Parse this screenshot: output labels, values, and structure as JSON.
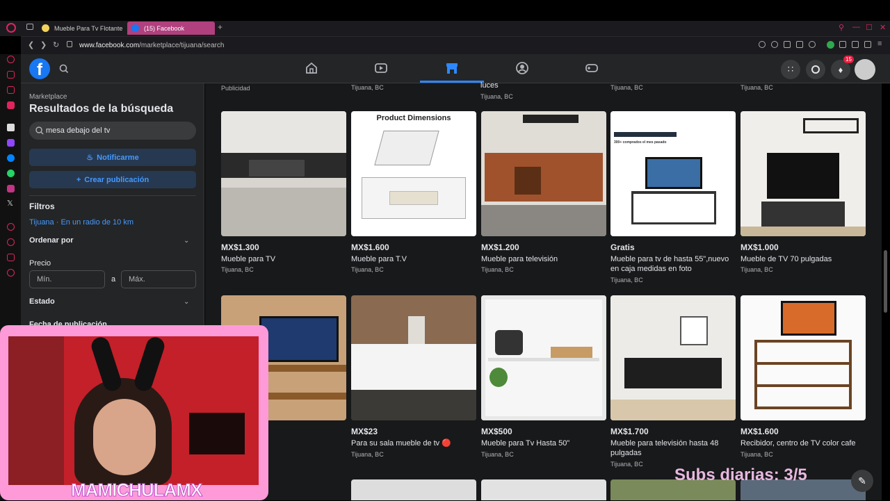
{
  "browser": {
    "tabs": [
      {
        "label": "Mueble Para Tv Flotante"
      },
      {
        "label": "(15) Facebook"
      }
    ],
    "new_tab": "+",
    "url_host": "www.facebook.com",
    "url_path": "/marketplace/tijuana/search"
  },
  "fb": {
    "logo": "f",
    "notif_count": "15"
  },
  "sidebar": {
    "crumb": "Marketplace",
    "title": "Resultados de la búsqueda",
    "search_value": "mesa debajo del tv",
    "notify_label": "Notificarme",
    "create_label": "Crear publicación",
    "filters_title": "Filtros",
    "location": "Tijuana · En un radio de 10 km",
    "sort_label": "Ordenar por",
    "price_label": "Precio",
    "min_placeholder": "Mín.",
    "to_label": "a",
    "max_placeholder": "Máx.",
    "state_label": "Estado",
    "date_label": "Fecha de publicación"
  },
  "top_row_labels": [
    "Publicidad",
    "Tijuana, BC",
    "luces",
    "Tijuana, BC",
    "Tijuana, BC",
    "Tijuana, BC"
  ],
  "listings_row1": [
    {
      "price": "MX$1.300",
      "title": "Mueble para TV",
      "location": "Tijuana, BC"
    },
    {
      "price": "MX$1.600",
      "title": "Mueble para T.V",
      "location": "Tijuana, BC",
      "img_text": "Product Dimensions"
    },
    {
      "price": "MX$1.200",
      "title": "Mueble para televisión",
      "location": "Tijuana, BC"
    },
    {
      "price": "Gratis",
      "title": "Mueble para tv de hasta 55\",nuevo en caja medidas en foto",
      "location": "Tijuana, BC",
      "img_text": "300+ comprados el mes pasado"
    },
    {
      "price": "MX$1.000",
      "title": "Mueble de TV 70 pulgadas",
      "location": "Tijuana, BC"
    }
  ],
  "listings_row2": [
    {
      "price": "",
      "title": "",
      "location": ""
    },
    {
      "price": "MX$23",
      "title": "Para su sala mueble de tv 🔴",
      "location": "Tijuana, BC"
    },
    {
      "price": "MX$500",
      "title": "Mueble para Tv Hasta 50\"",
      "location": "Tijuana, BC"
    },
    {
      "price": "MX$1.700",
      "title": "Mueble para televisión hasta 48 pulgadas",
      "location": "Tijuana, BC"
    },
    {
      "price": "MX$1.600",
      "title": "Recibidor, centro de TV color cafe",
      "location": "Tijuana, BC"
    }
  ],
  "overlay": {
    "streamer": "MAMICHULAMX",
    "subs": "Subs diarias: 3/5"
  },
  "colors": {
    "fb_blue": "#1877f2",
    "accent_blue": "#2d88ff",
    "tab_active": "#b0407e",
    "cam_frame": "#ff9ad9"
  }
}
